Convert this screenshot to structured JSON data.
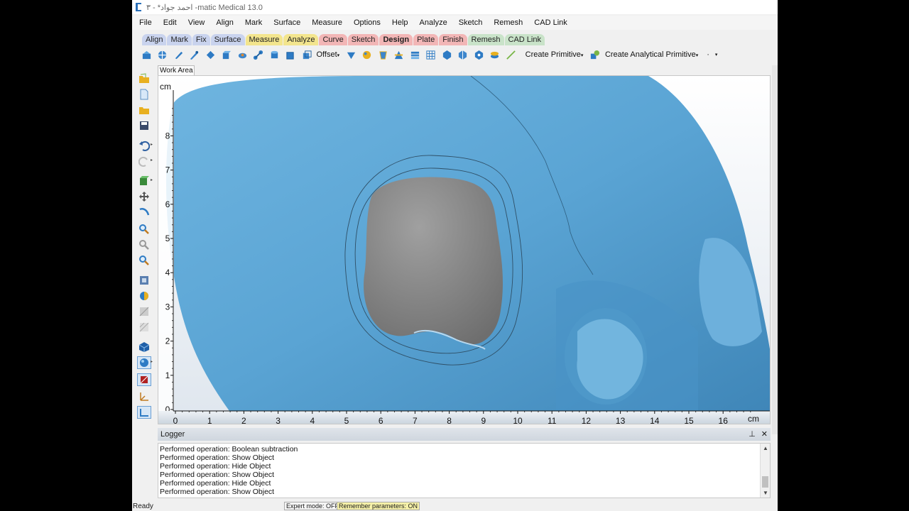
{
  "window": {
    "title": "احمد جواد* - ٣ -matic Medical 13.0"
  },
  "menubar": [
    "File",
    "Edit",
    "View",
    "Align",
    "Mark",
    "Surface",
    "Measure",
    "Options",
    "Help",
    "Analyze",
    "Sketch",
    "Remesh",
    "CAD Link"
  ],
  "ribbon_tabs": [
    {
      "label": "Align",
      "color": "#c9d3ee"
    },
    {
      "label": "Mark",
      "color": "#c9d3ee"
    },
    {
      "label": "Fix",
      "color": "#c9d3ee"
    },
    {
      "label": "Surface",
      "color": "#c9d3ee"
    },
    {
      "label": "Measure",
      "color": "#f3e58d"
    },
    {
      "label": "Analyze",
      "color": "#f3e58d"
    },
    {
      "label": "Curve",
      "color": "#f2b6b6"
    },
    {
      "label": "Sketch",
      "color": "#f2b6b6"
    },
    {
      "label": "Design",
      "color": "#f2b6b6"
    },
    {
      "label": "Plate",
      "color": "#f2b6b6"
    },
    {
      "label": "Finish",
      "color": "#f2b6b6"
    },
    {
      "label": "Remesh",
      "color": "#c9e3c9"
    },
    {
      "label": "CAD Link",
      "color": "#c9e3c9"
    }
  ],
  "toolbar": {
    "offset_label": "Offset",
    "create_primitive_label": "Create Primitive",
    "create_analytical_label": "Create Analytical Primitive"
  },
  "work_area": {
    "tab_label": "Work Area",
    "unit": "cm",
    "x_ticks": [
      "0",
      "1",
      "2",
      "3",
      "4",
      "5",
      "6",
      "7",
      "8",
      "9",
      "10",
      "11",
      "12",
      "13",
      "14",
      "15",
      "16"
    ],
    "y_ticks": [
      "0",
      "1",
      "2",
      "3",
      "4",
      "5",
      "6",
      "7",
      "8"
    ]
  },
  "logger": {
    "title": "Logger",
    "lines": [
      "Performed operation: Boolean subtraction",
      "Performed operation: Show Object",
      "Performed operation: Hide Object",
      "Performed operation: Show Object",
      "Performed operation: Hide Object",
      "Performed operation: Show Object"
    ]
  },
  "status": {
    "ready": "Ready",
    "expert_mode": "Expert mode: OFF",
    "remember_params": "Remember parameters: ON"
  },
  "colors": {
    "skull": "#5aa6d6",
    "defect": "#8c8c8c",
    "remember_badge": "#f5f0a8"
  }
}
